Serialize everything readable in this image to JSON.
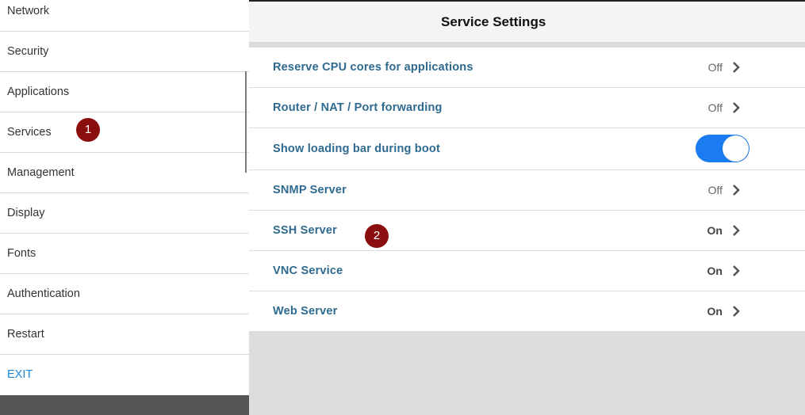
{
  "sidebar": {
    "items": [
      {
        "label": "Network"
      },
      {
        "label": "Security"
      },
      {
        "label": "Applications"
      },
      {
        "label": "Services"
      },
      {
        "label": "Management"
      },
      {
        "label": "Display"
      },
      {
        "label": "Fonts"
      },
      {
        "label": "Authentication"
      },
      {
        "label": "Restart"
      },
      {
        "label": "EXIT"
      }
    ]
  },
  "main": {
    "title": "Service Settings",
    "settings": [
      {
        "label": "Reserve CPU cores for applications",
        "value": "Off"
      },
      {
        "label": "Router / NAT / Port forwarding",
        "value": "Off"
      },
      {
        "label": "Show loading bar during boot",
        "toggle": "on"
      },
      {
        "label": "SNMP Server",
        "value": "Off"
      },
      {
        "label": "SSH Server",
        "value": "On"
      },
      {
        "label": "VNC Service",
        "value": "On"
      },
      {
        "label": "Web Server",
        "value": "On"
      }
    ]
  },
  "markers": [
    "1",
    "2"
  ],
  "colors": {
    "accent": "#1a7cf0",
    "label": "#2e6a8f",
    "marker": "#8b0e0e",
    "exit": "#1b87d8"
  }
}
